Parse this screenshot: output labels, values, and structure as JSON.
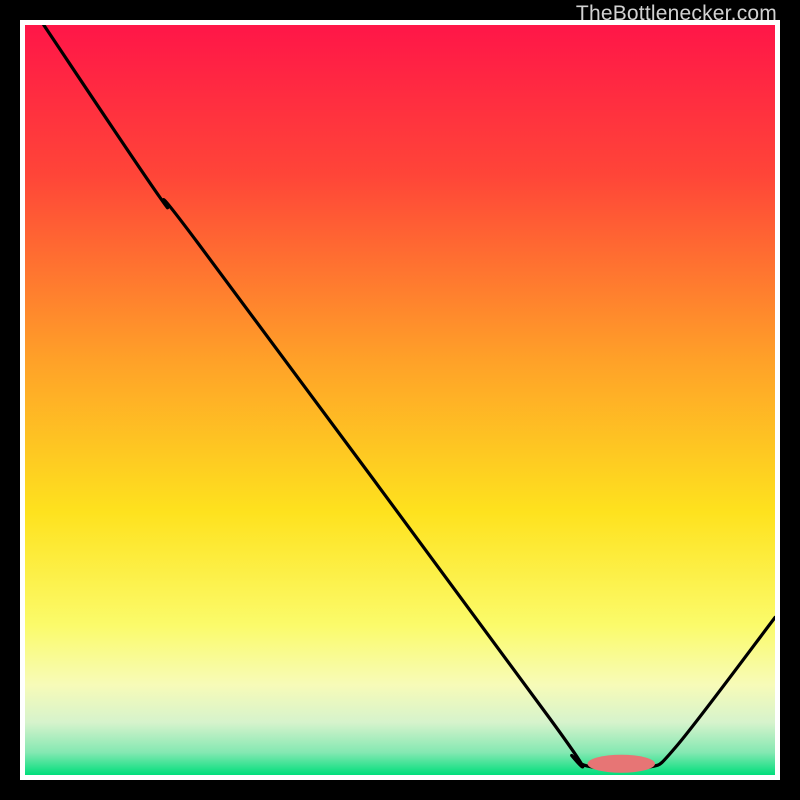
{
  "watermark": "TheBottlenecker.com",
  "chart_data": {
    "type": "line",
    "title": "",
    "xlabel": "",
    "ylabel": "",
    "xlim": [
      0,
      1
    ],
    "ylim": [
      0,
      1
    ],
    "background_gradient": {
      "stops": [
        {
          "offset": 0.0,
          "color": "#ff1648"
        },
        {
          "offset": 0.2,
          "color": "#ff4538"
        },
        {
          "offset": 0.45,
          "color": "#ffa228"
        },
        {
          "offset": 0.65,
          "color": "#fee21e"
        },
        {
          "offset": 0.8,
          "color": "#fbfb6a"
        },
        {
          "offset": 0.88,
          "color": "#f7fbb8"
        },
        {
          "offset": 0.93,
          "color": "#d6f3cc"
        },
        {
          "offset": 0.97,
          "color": "#84e8b2"
        },
        {
          "offset": 1.0,
          "color": "#00de7b"
        }
      ]
    },
    "series": [
      {
        "name": "bottleneck-curve",
        "stroke": "#000000",
        "points": [
          {
            "x": 0.025,
            "y": 1.0
          },
          {
            "x": 0.18,
            "y": 0.77
          },
          {
            "x": 0.23,
            "y": 0.71
          },
          {
            "x": 0.7,
            "y": 0.075
          },
          {
            "x": 0.73,
            "y": 0.025
          },
          {
            "x": 0.76,
            "y": 0.01
          },
          {
            "x": 0.83,
            "y": 0.01
          },
          {
            "x": 0.87,
            "y": 0.04
          },
          {
            "x": 1.0,
            "y": 0.21
          }
        ]
      }
    ],
    "marker": {
      "name": "sweet-spot",
      "color": "#e77575",
      "cx": 0.795,
      "cy": 0.015,
      "rx": 0.045,
      "ry": 0.012
    }
  }
}
